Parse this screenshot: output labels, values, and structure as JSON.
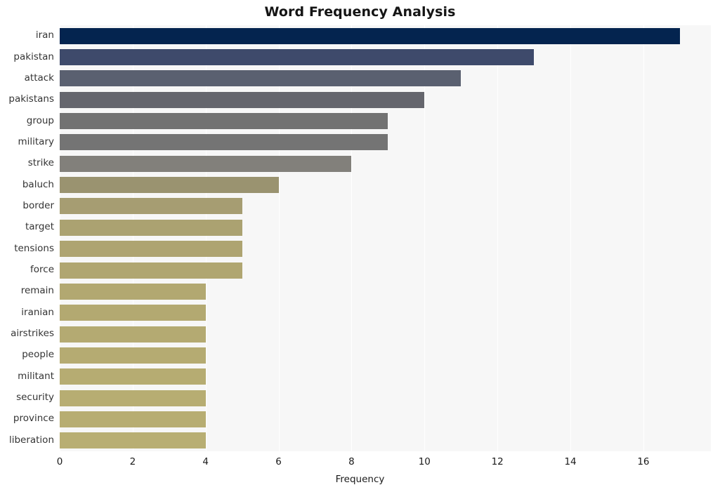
{
  "chart_data": {
    "type": "bar",
    "orientation": "horizontal",
    "title": "Word Frequency Analysis",
    "xlabel": "Frequency",
    "ylabel": "",
    "categories": [
      "iran",
      "pakistan",
      "attack",
      "pakistans",
      "group",
      "military",
      "strike",
      "baluch",
      "border",
      "target",
      "tensions",
      "force",
      "remain",
      "iranian",
      "airstrikes",
      "people",
      "militant",
      "security",
      "province",
      "liberation"
    ],
    "values": [
      17,
      13,
      11,
      10,
      9,
      9,
      8,
      6,
      5,
      5,
      5,
      5,
      4,
      4,
      4,
      4,
      4,
      4,
      4,
      4
    ],
    "bar_colors": [
      "#04244f",
      "#3e4a6b",
      "#5a6070",
      "#65666d",
      "#727272",
      "#747474",
      "#82807b",
      "#9a9370",
      "#a69d72",
      "#aba271",
      "#aea471",
      "#b0a671",
      "#b2a871",
      "#b3a971",
      "#b4aa72",
      "#b5ab72",
      "#b6ac72",
      "#b7ad72",
      "#b7ad72",
      "#b8ae73"
    ],
    "xlim": [
      0,
      17.85
    ],
    "xticks": [
      0,
      2,
      4,
      6,
      8,
      10,
      12,
      14,
      16
    ],
    "xtick_labels": [
      "0",
      "2",
      "4",
      "6",
      "8",
      "10",
      "12",
      "14",
      "16"
    ],
    "grid": true,
    "grid_axis": "x",
    "grid_color": "#ffffff",
    "plot_background": "#f7f7f7",
    "figure_background": "#ffffff",
    "legend": null
  }
}
